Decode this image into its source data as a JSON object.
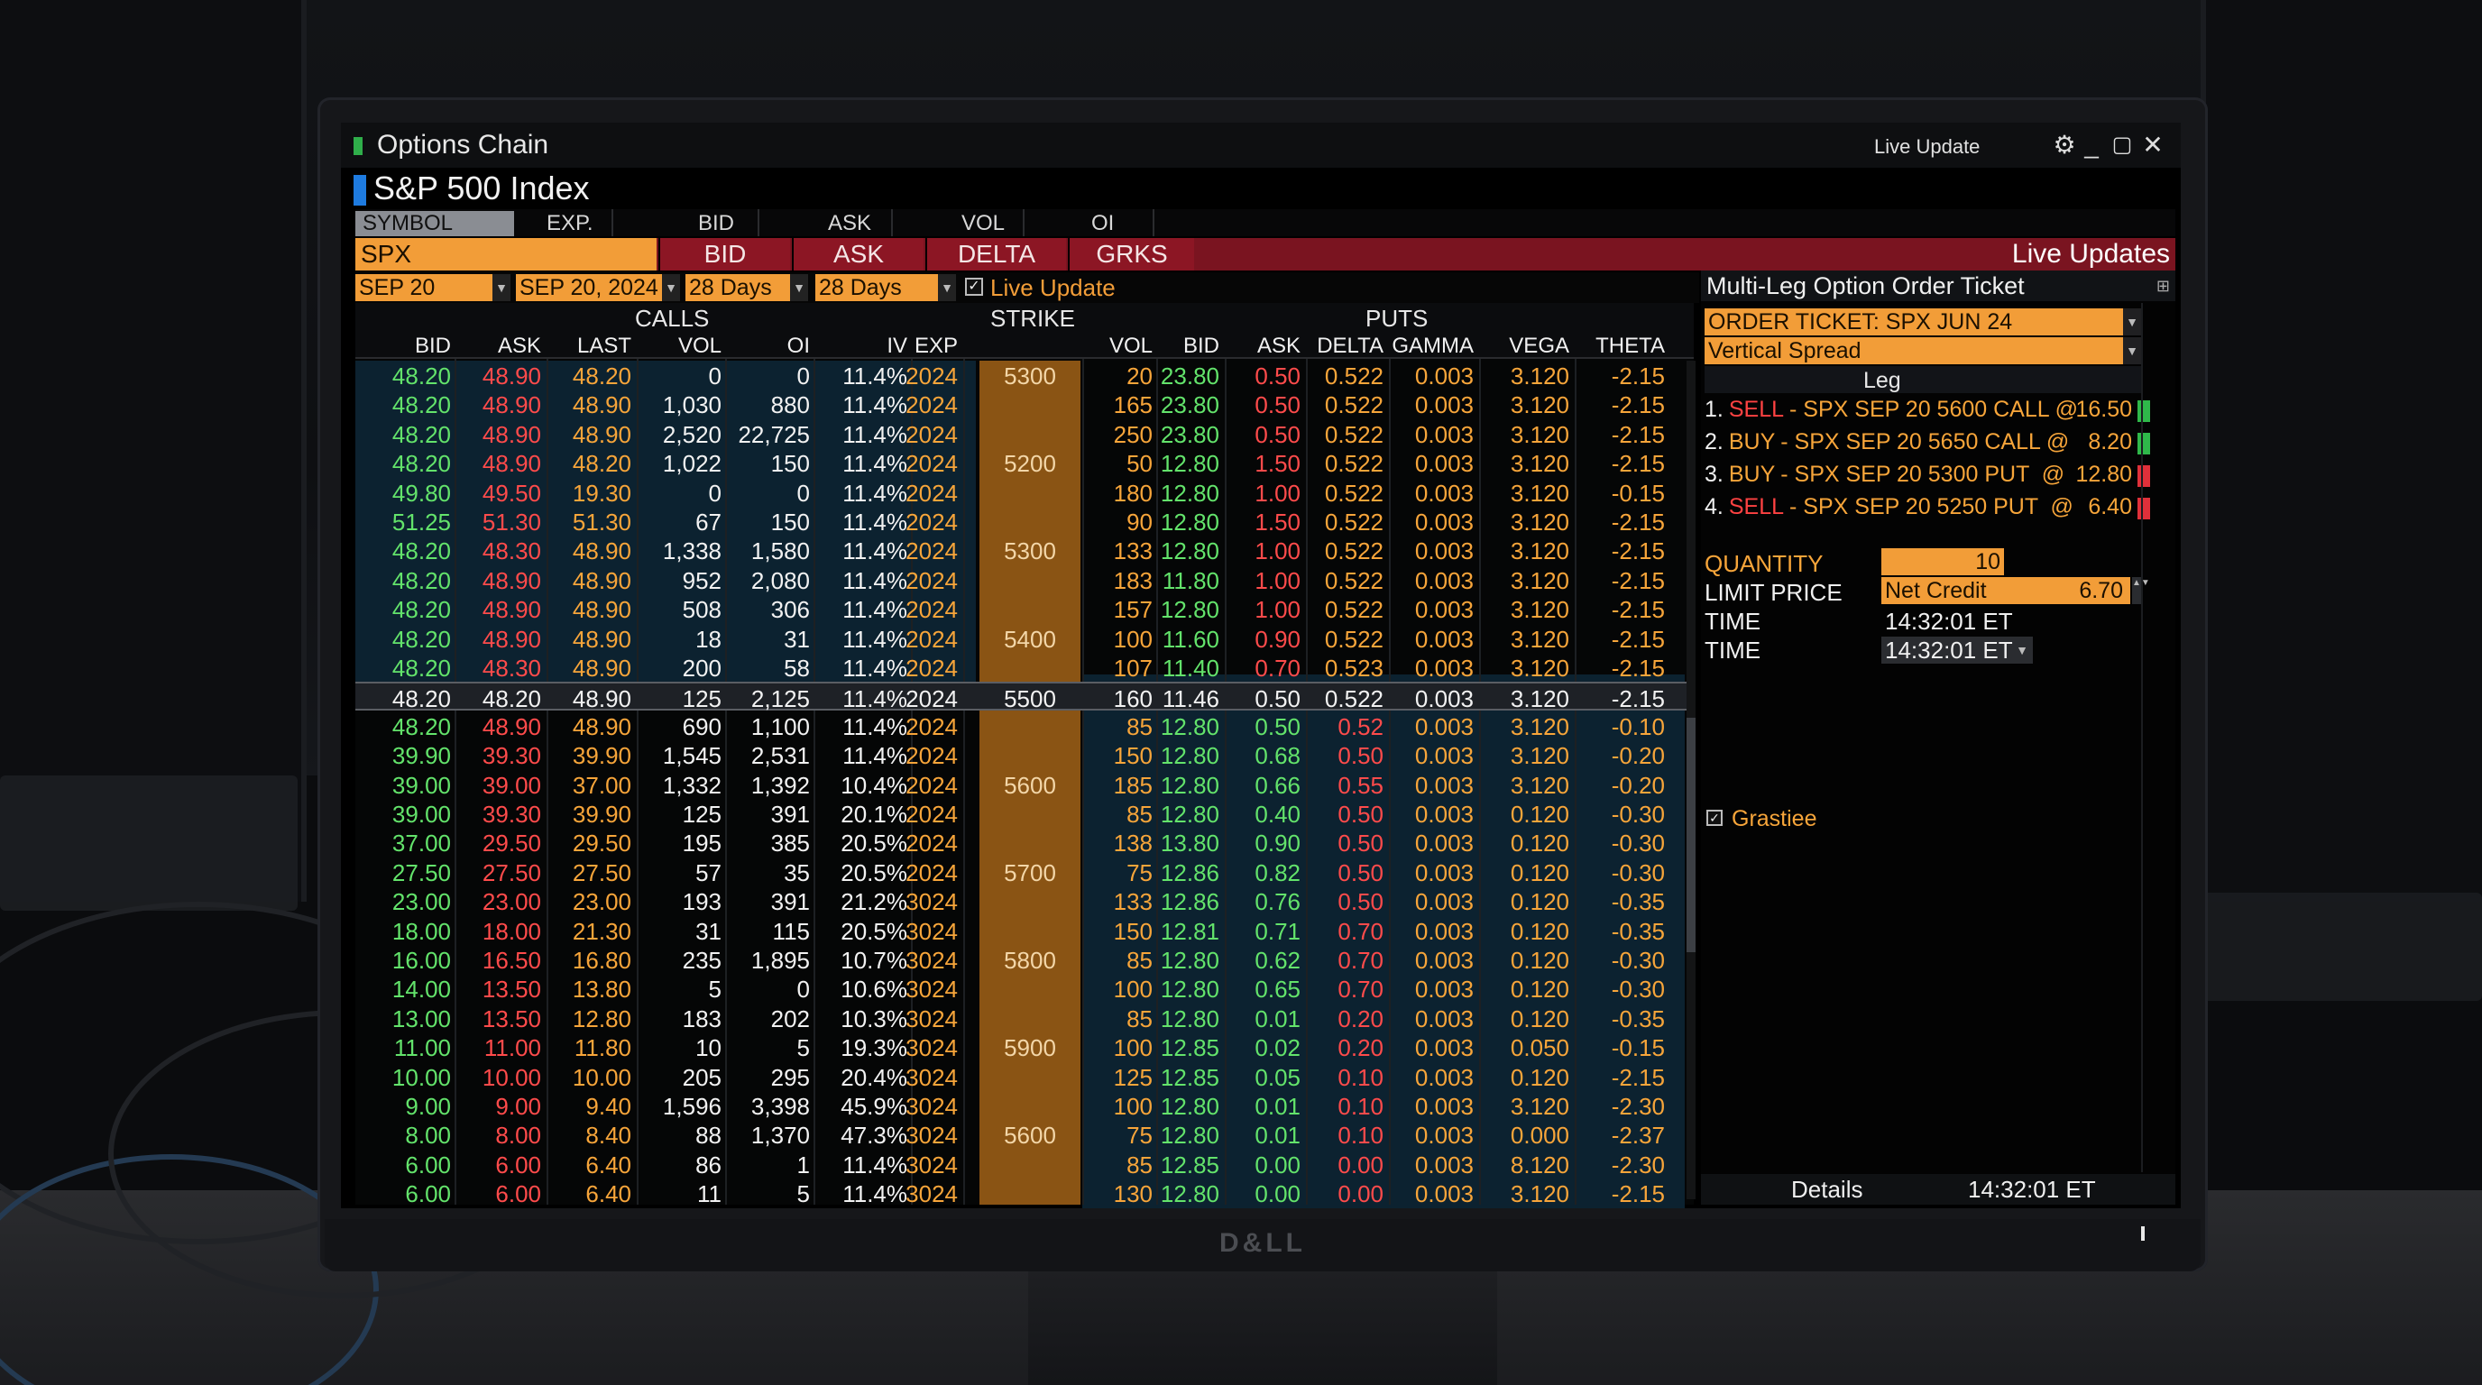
{
  "window": {
    "title": "Options Chain",
    "live_update_label": "Live Update",
    "subtitle": "S&P 500 Index"
  },
  "fieldbar": [
    "SYMBOL",
    "EXP.",
    "BID",
    "ASK",
    "VOL",
    "OI"
  ],
  "tabs": {
    "symbol": "SPX",
    "items": [
      "BID",
      "ASK",
      "DELTA",
      "GRKS"
    ],
    "live_updates": "Live Updates"
  },
  "selectors": {
    "expiry": "SEP 20",
    "date": "SEP 20, 2024",
    "days1": "28 Days",
    "days2": "28 Days",
    "live_update": "Live Update"
  },
  "chain": {
    "groups": {
      "calls": "CALLS",
      "strike": "STRIKE",
      "puts": "PUTS"
    },
    "call_headers": [
      "BID",
      "ASK",
      "LAST",
      "VOL",
      "OI",
      "IV",
      "EXP"
    ],
    "put_headers": [
      "VOL",
      "BID",
      "ASK",
      "DELTA",
      "GAMMA",
      "VEGA",
      "THETA"
    ],
    "rows": [
      [
        "48.20",
        "48.90",
        "48.20",
        "0",
        "0",
        "11.4%",
        "2024",
        "5300",
        "20",
        "23.80",
        "0.50",
        "0.522",
        "0.003",
        "3.120",
        "-2.15"
      ],
      [
        "48.20",
        "48.90",
        "48.90",
        "1,030",
        "880",
        "11.4%",
        "2024",
        "",
        "165",
        "23.80",
        "0.50",
        "0.522",
        "0.003",
        "3.120",
        "-2.15"
      ],
      [
        "48.20",
        "48.90",
        "48.90",
        "2,520",
        "22,725",
        "11.4%",
        "2024",
        "",
        "250",
        "23.80",
        "0.50",
        "0.522",
        "0.003",
        "3.120",
        "-2.15"
      ],
      [
        "48.20",
        "48.90",
        "48.20",
        "1,022",
        "150",
        "11.4%",
        "2024",
        "5200",
        "50",
        "12.80",
        "1.50",
        "0.522",
        "0.003",
        "3.120",
        "-2.15"
      ],
      [
        "49.80",
        "49.50",
        "19.30",
        "0",
        "0",
        "11.4%",
        "2024",
        "",
        "180",
        "12.80",
        "1.00",
        "0.522",
        "0.003",
        "3.120",
        "-0.15"
      ],
      [
        "51.25",
        "51.30",
        "51.30",
        "67",
        "150",
        "11.4%",
        "2024",
        "",
        "90",
        "12.80",
        "1.50",
        "0.522",
        "0.003",
        "3.120",
        "-2.15"
      ],
      [
        "48.20",
        "48.30",
        "48.90",
        "1,338",
        "1,580",
        "11.4%",
        "2024",
        "5300",
        "133",
        "12.80",
        "1.00",
        "0.522",
        "0.003",
        "3.120",
        "-2.15"
      ],
      [
        "48.20",
        "48.90",
        "48.90",
        "952",
        "2,080",
        "11.4%",
        "2024",
        "",
        "183",
        "11.80",
        "1.00",
        "0.522",
        "0.003",
        "3.120",
        "-2.15"
      ],
      [
        "48.20",
        "48.90",
        "48.90",
        "508",
        "306",
        "11.4%",
        "2024",
        "",
        "157",
        "12.80",
        "1.00",
        "0.522",
        "0.003",
        "3.120",
        "-2.15"
      ],
      [
        "48.20",
        "48.90",
        "48.90",
        "18",
        "31",
        "11.4%",
        "2024",
        "5400",
        "100",
        "11.60",
        "0.90",
        "0.522",
        "0.003",
        "3.120",
        "-2.15"
      ],
      [
        "48.20",
        "48.30",
        "48.90",
        "200",
        "58",
        "11.4%",
        "2024",
        "",
        "107",
        "11.40",
        "0.70",
        "0.523",
        "0.003",
        "3.120",
        "-2.15"
      ],
      [
        "48.20",
        "48.20",
        "48.90",
        "125",
        "2,125",
        "11.4%",
        "2024",
        "5500",
        "160",
        "11.46",
        "0.50",
        "0.522",
        "0.003",
        "3.120",
        "-2.15"
      ],
      [
        "48.20",
        "48.90",
        "48.90",
        "690",
        "1,100",
        "11.4%",
        "2024",
        "",
        "85",
        "12.80",
        "0.50",
        "0.52",
        "0.003",
        "3.120",
        "-0.10"
      ],
      [
        "39.90",
        "39.30",
        "39.90",
        "1,545",
        "2,531",
        "11.4%",
        "2024",
        "",
        "150",
        "12.80",
        "0.68",
        "0.50",
        "0.003",
        "3.120",
        "-0.20"
      ],
      [
        "39.00",
        "39.00",
        "37.00",
        "1,332",
        "1,392",
        "10.4%",
        "2024",
        "5600",
        "185",
        "12.80",
        "0.66",
        "0.55",
        "0.003",
        "3.120",
        "-0.20"
      ],
      [
        "39.00",
        "39.30",
        "39.90",
        "125",
        "391",
        "20.1%",
        "2024",
        "",
        "85",
        "12.80",
        "0.40",
        "0.50",
        "0.003",
        "0.120",
        "-0.30"
      ],
      [
        "37.00",
        "29.50",
        "29.50",
        "195",
        "385",
        "20.5%",
        "2024",
        "",
        "138",
        "13.80",
        "0.90",
        "0.50",
        "0.003",
        "0.120",
        "-0.30"
      ],
      [
        "27.50",
        "27.50",
        "27.50",
        "57",
        "35",
        "20.5%",
        "2024",
        "5700",
        "75",
        "12.86",
        "0.82",
        "0.50",
        "0.003",
        "0.120",
        "-0.30"
      ],
      [
        "23.00",
        "23.00",
        "23.00",
        "193",
        "391",
        "21.2%",
        "3024",
        "",
        "133",
        "12.86",
        "0.76",
        "0.50",
        "0.003",
        "0.120",
        "-0.35"
      ],
      [
        "18.00",
        "18.00",
        "21.30",
        "31",
        "115",
        "20.5%",
        "3024",
        "",
        "150",
        "12.81",
        "0.71",
        "0.70",
        "0.003",
        "0.120",
        "-0.35"
      ],
      [
        "16.00",
        "16.50",
        "16.80",
        "235",
        "1,895",
        "10.7%",
        "3024",
        "5800",
        "85",
        "12.80",
        "0.62",
        "0.70",
        "0.003",
        "0.120",
        "-0.30"
      ],
      [
        "14.00",
        "13.50",
        "13.80",
        "5",
        "0",
        "10.6%",
        "3024",
        "",
        "100",
        "12.80",
        "0.65",
        "0.70",
        "0.003",
        "0.120",
        "-0.30"
      ],
      [
        "13.00",
        "13.50",
        "12.80",
        "183",
        "202",
        "10.3%",
        "3024",
        "",
        "85",
        "12.80",
        "0.01",
        "0.20",
        "0.003",
        "0.120",
        "-0.35"
      ],
      [
        "11.00",
        "11.00",
        "11.80",
        "10",
        "5",
        "19.3%",
        "3024",
        "5900",
        "100",
        "12.85",
        "0.02",
        "0.20",
        "0.003",
        "0.050",
        "-0.15"
      ],
      [
        "10.00",
        "10.00",
        "10.00",
        "205",
        "295",
        "20.4%",
        "3024",
        "",
        "125",
        "12.85",
        "0.05",
        "0.10",
        "0.003",
        "0.120",
        "-2.15"
      ],
      [
        "9.00",
        "9.00",
        "9.40",
        "1,596",
        "3,398",
        "45.9%",
        "3024",
        "",
        "100",
        "12.80",
        "0.01",
        "0.10",
        "0.003",
        "3.120",
        "-2.30"
      ],
      [
        "8.00",
        "8.00",
        "8.40",
        "88",
        "1,370",
        "47.3%",
        "3024",
        "5600",
        "75",
        "12.80",
        "0.01",
        "0.10",
        "0.003",
        "0.000",
        "-2.37"
      ],
      [
        "6.00",
        "6.00",
        "6.40",
        "86",
        "1",
        "11.4%",
        "3024",
        "",
        "85",
        "12.85",
        "0.00",
        "0.00",
        "0.003",
        "8.120",
        "-2.30"
      ],
      [
        "6.00",
        "6.00",
        "6.40",
        "11",
        "5",
        "11.4%",
        "3024",
        "",
        "130",
        "12.80",
        "0.00",
        "0.00",
        "0.003",
        "3.120",
        "-2.15"
      ]
    ]
  },
  "ticket": {
    "title": "Multi-Leg Option Order Ticket",
    "order_ticket": "ORDER TICKET: SPX JUN 24",
    "strategy": "Vertical Spread",
    "leg_header": "Leg",
    "legs": [
      {
        "num": "1.",
        "side": "SELL",
        "desc": "- SPX SEP 20 5600 CALL @",
        "price": "16.50",
        "color": "#2fb84a"
      },
      {
        "num": "2.",
        "side": "BUY",
        "desc": "- SPX SEP 20 5650 CALL @",
        "price": "8.20",
        "color": "#2fb84a"
      },
      {
        "num": "3.",
        "side": "BUY",
        "desc": "- SPX SEP 20 5300 PUT  @",
        "price": "12.80",
        "color": "#e0303a"
      },
      {
        "num": "4.",
        "side": "SELL",
        "desc": "- SPX SEP 20 5250 PUT  @",
        "price": "6.40",
        "color": "#e0303a"
      }
    ],
    "quantity_label": "QUANTITY",
    "quantity": "10",
    "limit_label": "LIMIT PRICE",
    "limit_type": "Net Credit",
    "limit_value": "6.70",
    "time_label1": "TIME",
    "time_value1": "14:32:01 ET",
    "time_label2": "TIME",
    "time_value2": "14:32:01 ET",
    "check_label": "Grastiee",
    "footer_details": "Details",
    "footer_time": "14:32:01 ET"
  },
  "brand": "D&LL",
  "colors": {
    "accent_orange": "#f29d38",
    "bid_green": "#63e36b",
    "ask_red": "#ff4b4b",
    "header_red": "#7a1420"
  }
}
